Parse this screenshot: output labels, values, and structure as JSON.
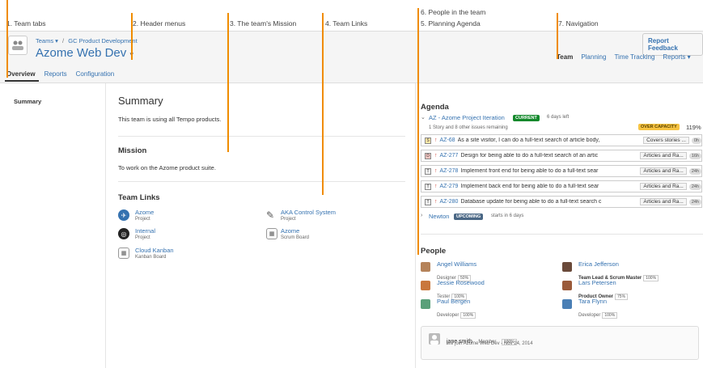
{
  "callouts": {
    "c1": "1. Team tabs",
    "c2": "2. Header menus",
    "c3": "3. The team's Mission",
    "c4": "4. Team Links",
    "c5": "5. Planning Agenda",
    "c6": "6. People in the team",
    "c7": "7. Navigation"
  },
  "colors": {
    "accent": "#f08c00",
    "link": "#3572b0",
    "current": "#14892c",
    "upcoming": "#4a6785",
    "overcapacity": "#f6c342"
  },
  "header": {
    "breadcrumb_teams": "Teams ▾",
    "breadcrumb_sep": "/",
    "breadcrumb_program": "GC Product Development",
    "title": "Azome Web Dev",
    "title_menu_icon": "▾",
    "report_feedback": "Report Feedback",
    "avatar_icon": "team-icon"
  },
  "nav": {
    "items": [
      "Team",
      "Planning",
      "Time Tracking",
      "Reports ▾"
    ]
  },
  "tabs": [
    "Overview",
    "Reports",
    "Configuration"
  ],
  "sidebar": {
    "items": [
      "Summary"
    ]
  },
  "summary": {
    "title": "Summary",
    "text": "This team is using all Tempo products."
  },
  "mission": {
    "title": "Mission",
    "text": "To work on the Azome product suite."
  },
  "links": {
    "title": "Team Links",
    "items": [
      {
        "name": "Azome",
        "type": "Project",
        "icon": "project-icon"
      },
      {
        "name": "AKA Control System",
        "type": "Project",
        "icon": "wrench-icon"
      },
      {
        "name": "Internal",
        "type": "Project",
        "icon": "project-icon"
      },
      {
        "name": "Azome",
        "type": "Scrum Board",
        "icon": "board-icon"
      },
      {
        "name": "Cloud Kanban",
        "type": "Kanban Board",
        "icon": "board-icon"
      }
    ]
  },
  "agenda": {
    "title": "Agenda",
    "iteration": "AZ - Azome Project Iteration",
    "status": "CURRENT",
    "days_left": "6 days left",
    "remaining": "1 Story and 8 other issues remaining",
    "capacity": "OVER CAPACITY",
    "capacity_pct": "119%",
    "issues": [
      {
        "key": "AZ-68",
        "summary": "As a site visitor, I can do a full-text search of article body,",
        "epic": "Covers stories ...",
        "est": "0h",
        "type": "S"
      },
      {
        "key": "AZ-277",
        "summary": "Design for being able to do a full-text search of an artic",
        "epic": "Articles and Ra...",
        "est": "16h",
        "type": "D"
      },
      {
        "key": "AZ-278",
        "summary": "Implement front end for being able to do a full-text sear",
        "epic": "Articles and Ra...",
        "est": "24h",
        "type": "T"
      },
      {
        "key": "AZ-279",
        "summary": "Implement back end for being able to do a full-text sear",
        "epic": "Articles and Ra...",
        "est": "24h",
        "type": "T"
      },
      {
        "key": "AZ-280",
        "summary": "Database update for being able to do a full-text search c",
        "epic": "Articles and Ra...",
        "est": "24h",
        "type": "T"
      }
    ],
    "next_iteration": "Newton",
    "next_status": "UPCOMING",
    "next_starts": "starts in 6 days"
  },
  "people": {
    "title": "People",
    "members": [
      {
        "name": "Angel Williams",
        "role": "Designer",
        "pct": "50%"
      },
      {
        "name": "Erica Jefferson",
        "role": "Team Lead & Scrum Master",
        "pct": "100%"
      },
      {
        "name": "Jessie Rosewood",
        "role": "Tester",
        "pct": "100%"
      },
      {
        "name": "Lars Petersen",
        "role": "Product Owner",
        "pct": "75%"
      },
      {
        "name": "Paul Bergen",
        "role": "Developer",
        "pct": "100%"
      },
      {
        "name": "Tara Flynn",
        "role": "Developer",
        "pct": "100%"
      }
    ],
    "joining": {
      "name": "jane smith",
      "role": "Member",
      "pct": "100%",
      "note": "will join Azome Web Dev - Nov 24, 2014"
    }
  }
}
